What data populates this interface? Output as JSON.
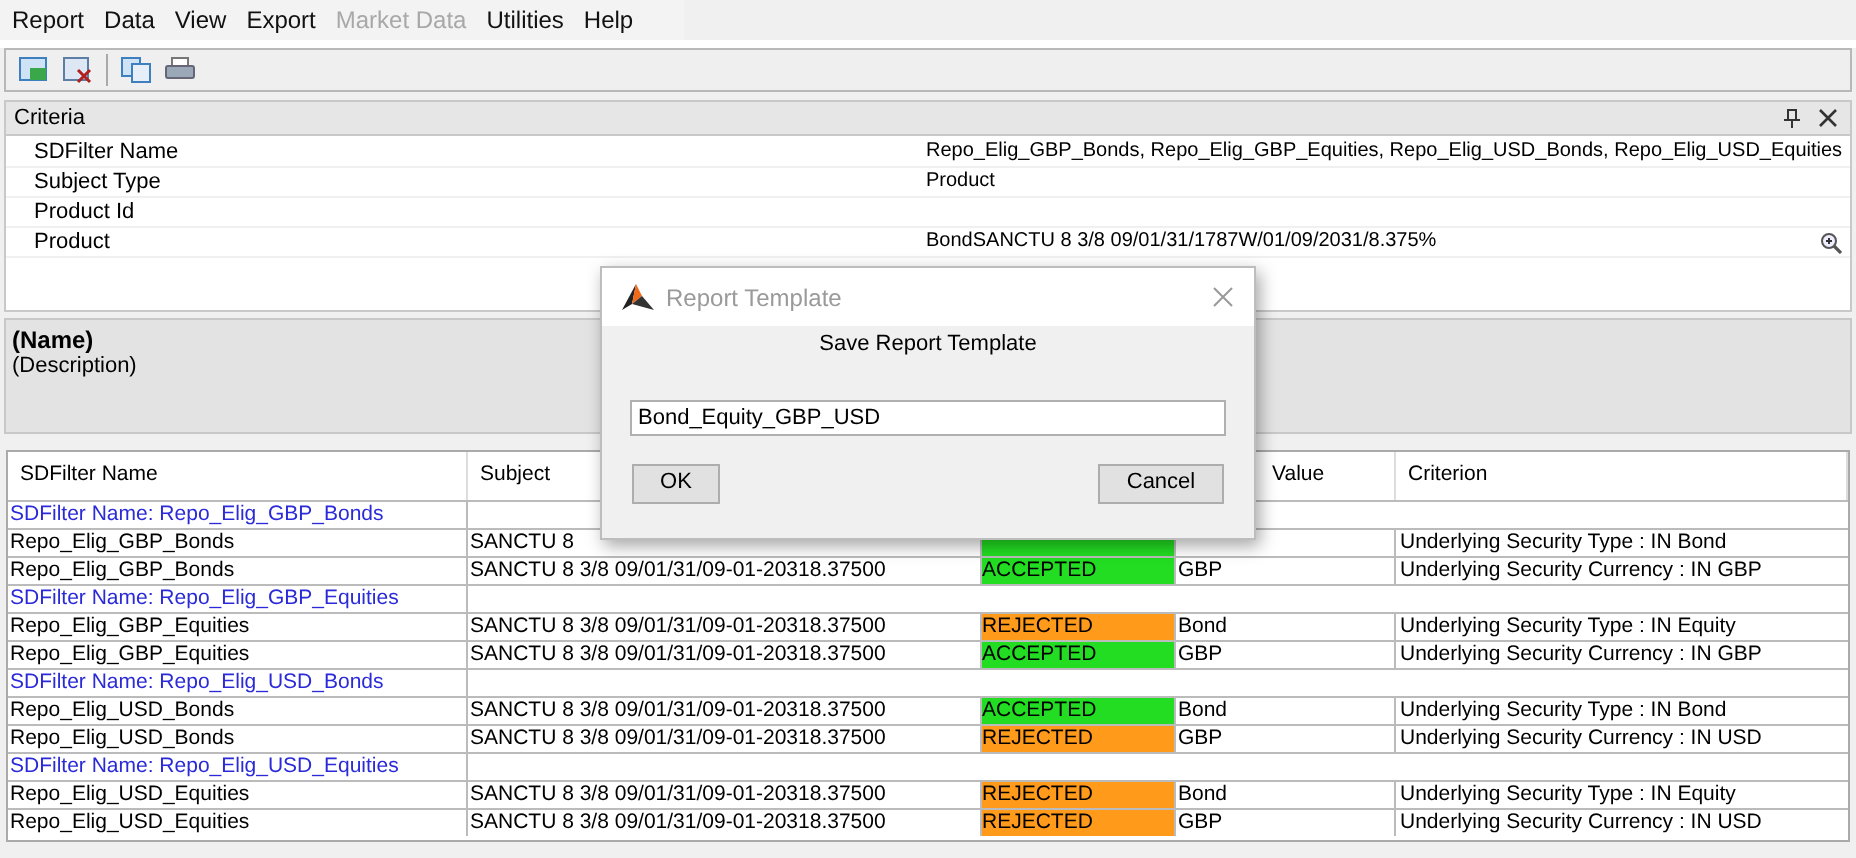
{
  "menu": [
    {
      "label": "Report",
      "disabled": false
    },
    {
      "label": "Data",
      "disabled": false
    },
    {
      "label": "View",
      "disabled": false
    },
    {
      "label": "Export",
      "disabled": false
    },
    {
      "label": "Market Data",
      "disabled": true
    },
    {
      "label": "Utilities",
      "disabled": false
    },
    {
      "label": "Help",
      "disabled": false
    }
  ],
  "criteria": {
    "title": "Criteria",
    "rows": [
      {
        "label": "SDFilter Name",
        "value": "Repo_Elig_GBP_Bonds, Repo_Elig_GBP_Equities, Repo_Elig_USD_Bonds, Repo_Elig_USD_Equities"
      },
      {
        "label": "Subject Type",
        "value": "Product"
      },
      {
        "label": "Product Id"
      },
      {
        "label": "Product",
        "value": "BondSANCTU 8 3/8 09/01/31/1787W/01/09/2031/8.375%",
        "lookup": true
      }
    ]
  },
  "description": {
    "name": "(Name)",
    "text": "(Description)"
  },
  "table": {
    "columns": [
      {
        "label": "SDFilter Name"
      },
      {
        "label": "Subject"
      },
      {},
      {
        "label": "Value"
      },
      {
        "label": "Criterion"
      }
    ],
    "rows": [
      {
        "kind": "group",
        "name": "SDFilter Name: Repo_Elig_GBP_Bonds"
      },
      {
        "kind": "data",
        "name": "Repo_Elig_GBP_Bonds",
        "subject": "SANCTU 8",
        "status": {
          "color": "#22dd22"
        },
        "criterion": "Underlying Security Type : IN Bond"
      },
      {
        "kind": "data",
        "name": "Repo_Elig_GBP_Bonds",
        "subject": "SANCTU 8 3/8 09/01/31/09-01-20318.37500",
        "status": {
          "text": "ACCEPTED",
          "color": "#22dd22"
        },
        "value": "GBP",
        "criterion": "Underlying Security Currency : IN GBP"
      },
      {
        "kind": "group",
        "name": "SDFilter Name: Repo_Elig_GBP_Equities"
      },
      {
        "kind": "data",
        "name": "Repo_Elig_GBP_Equities",
        "subject": "SANCTU 8 3/8 09/01/31/09-01-20318.37500",
        "status": {
          "text": "REJECTED",
          "color": "#ff9a1a"
        },
        "value": "Bond",
        "criterion": "Underlying Security Type : IN Equity"
      },
      {
        "kind": "data",
        "name": "Repo_Elig_GBP_Equities",
        "subject": "SANCTU 8 3/8 09/01/31/09-01-20318.37500",
        "status": {
          "text": "ACCEPTED",
          "color": "#22dd22"
        },
        "value": "GBP",
        "criterion": "Underlying Security Currency : IN GBP"
      },
      {
        "kind": "group",
        "name": "SDFilter Name: Repo_Elig_USD_Bonds"
      },
      {
        "kind": "data",
        "name": "Repo_Elig_USD_Bonds",
        "subject": "SANCTU 8 3/8 09/01/31/09-01-20318.37500",
        "status": {
          "text": "ACCEPTED",
          "color": "#22dd22"
        },
        "value": "Bond",
        "criterion": "Underlying Security Type : IN Bond"
      },
      {
        "kind": "data",
        "name": "Repo_Elig_USD_Bonds",
        "subject": "SANCTU 8 3/8 09/01/31/09-01-20318.37500",
        "status": {
          "text": "REJECTED",
          "color": "#ff9a1a"
        },
        "value": "GBP",
        "criterion": "Underlying Security Currency : IN USD"
      },
      {
        "kind": "group",
        "name": "SDFilter Name: Repo_Elig_USD_Equities"
      },
      {
        "kind": "data",
        "name": "Repo_Elig_USD_Equities",
        "subject": "SANCTU 8 3/8 09/01/31/09-01-20318.37500",
        "status": {
          "text": "REJECTED",
          "color": "#ff9a1a"
        },
        "value": "Bond",
        "criterion": "Underlying Security Type : IN Equity"
      },
      {
        "kind": "data",
        "name": "Repo_Elig_USD_Equities",
        "subject": "SANCTU 8 3/8 09/01/31/09-01-20318.37500",
        "status": {
          "text": "REJECTED",
          "color": "#ff9a1a"
        },
        "value": "GBP",
        "criterion": "Underlying Security Currency : IN USD"
      }
    ]
  },
  "dialog": {
    "title": "Report Template",
    "heading": "Save Report Template",
    "value": "Bond_Equity_GBP_USD",
    "buttons": [
      "OK",
      "Cancel"
    ]
  }
}
